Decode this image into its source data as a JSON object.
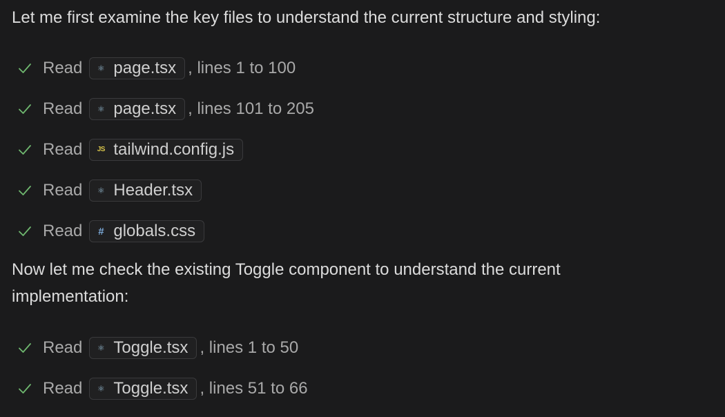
{
  "messages": {
    "intro": "Let me first examine the key files to understand the current structure and styling:",
    "followup": "Now let me check the existing Toggle component to understand the current implementation:"
  },
  "steps": [
    {
      "verb": "Read",
      "file": "page.tsx",
      "icon": "react-icon",
      "suffix": ", lines 1 to 100"
    },
    {
      "verb": "Read",
      "file": "page.tsx",
      "icon": "react-icon",
      "suffix": ", lines 101 to 205"
    },
    {
      "verb": "Read",
      "file": "tailwind.config.js",
      "icon": "js-file-icon",
      "icon_text": "JS",
      "suffix": ""
    },
    {
      "verb": "Read",
      "file": "Header.tsx",
      "icon": "react-icon",
      "suffix": ""
    },
    {
      "verb": "Read",
      "file": "globals.css",
      "icon": "css-file-icon",
      "icon_text": "#",
      "suffix": ""
    },
    {
      "verb": "Read",
      "file": "Toggle.tsx",
      "icon": "react-icon",
      "suffix": ", lines 1 to 50"
    },
    {
      "verb": "Read",
      "file": "Toggle.tsx",
      "icon": "react-icon",
      "suffix": ", lines 51 to 66"
    }
  ],
  "colors": {
    "background": "#1b1b1c",
    "check": "#6fb86f",
    "js_icon": "#d8c44a",
    "react_icon": "#8fb3c9",
    "css_icon": "#7aa7d6"
  }
}
